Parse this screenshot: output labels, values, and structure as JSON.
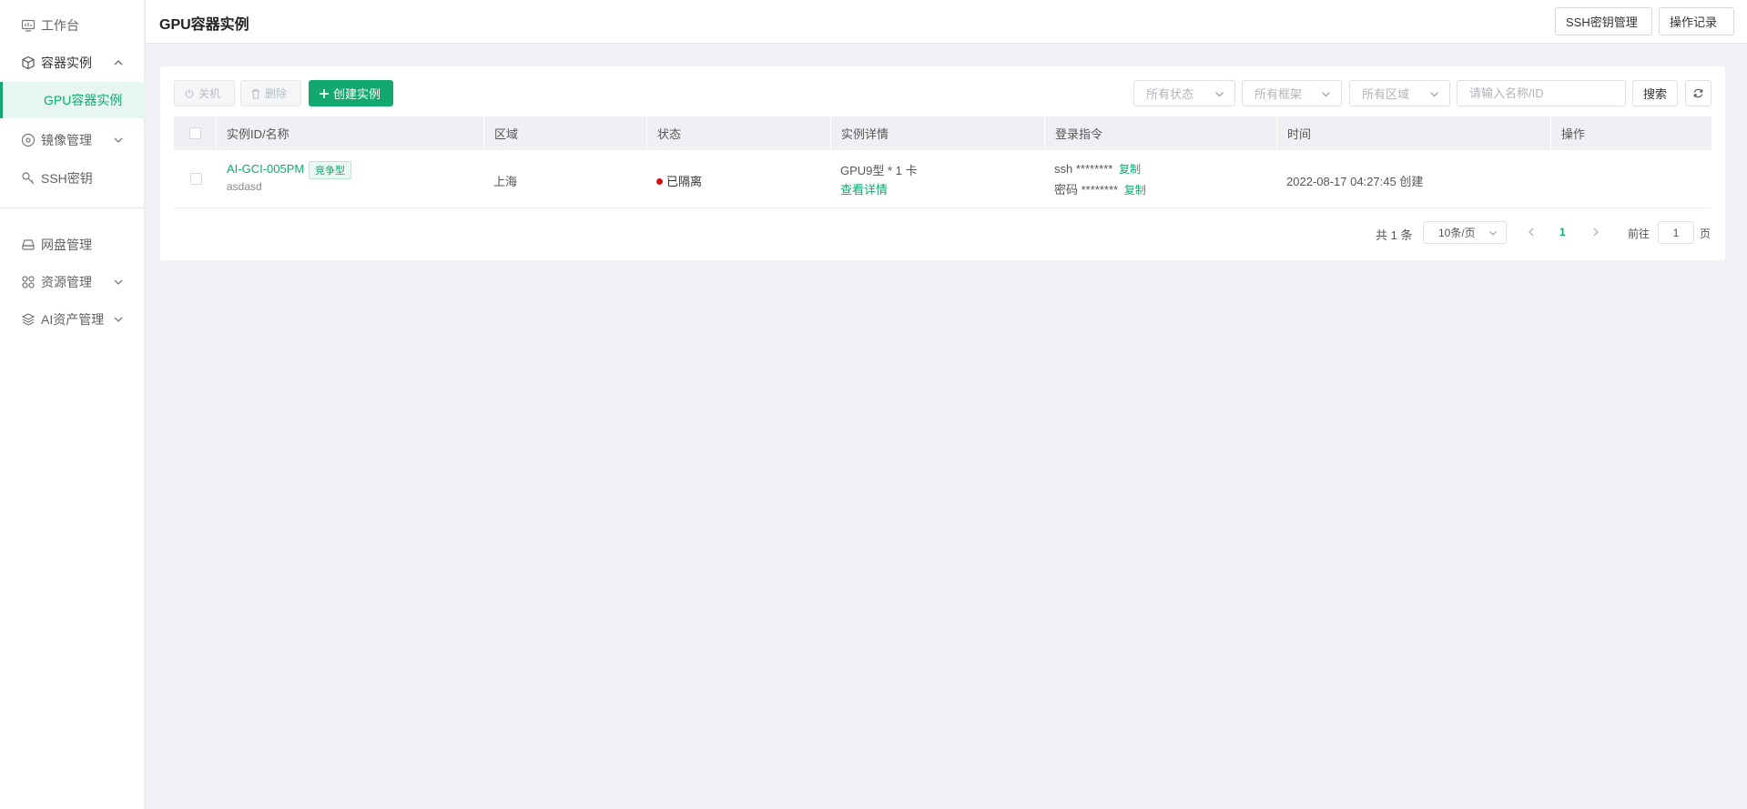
{
  "sidebar": {
    "items": [
      {
        "label": "工作台",
        "icon": "dashboard-icon"
      },
      {
        "label": "容器实例",
        "icon": "cube-icon",
        "expanded": true,
        "children": [
          {
            "label": "GPU容器实例",
            "active": true
          }
        ]
      },
      {
        "label": "镜像管理",
        "icon": "disc-icon"
      },
      {
        "label": "SSH密钥",
        "icon": "key-icon"
      },
      {
        "label": "网盘管理",
        "icon": "drive-icon"
      },
      {
        "label": "资源管理",
        "icon": "grid-icon"
      },
      {
        "label": "AI资产管理",
        "icon": "layers-icon"
      }
    ]
  },
  "header": {
    "title": "GPU容器实例",
    "ssh_key_button": "SSH密钥管理",
    "op_log_button": "操作记录"
  },
  "toolbar": {
    "shutdown_label": "关机",
    "delete_label": "删除",
    "create_label": "创建实例",
    "status_filter": "所有状态",
    "framework_filter": "所有框架",
    "region_filter": "所有区域",
    "search_placeholder": "请输入名称/ID",
    "search_label": "搜索"
  },
  "table": {
    "columns": [
      "实例ID/名称",
      "区域",
      "状态",
      "实例详情",
      "登录指令",
      "时间",
      "操作"
    ],
    "rows": [
      {
        "id": "AI-GCI-005PM",
        "name": "asdasd",
        "tag": "竞争型",
        "region": "上海",
        "status": "已隔离",
        "detail": "GPU9型 * 1 卡",
        "detail_link": "查看详情",
        "ssh_label": "ssh ********",
        "pwd_label": "密码 ********",
        "copy": "复制",
        "time": "2022-08-17 04:27:45 创建"
      }
    ]
  },
  "pagination": {
    "total": "共 1 条",
    "page_size": "10条/页",
    "current": "1",
    "goto_prefix": "前往",
    "goto_value": "1",
    "goto_suffix": "页"
  },
  "colors": {
    "accent": "#12a870",
    "status_isolated": "#d40f0f"
  }
}
